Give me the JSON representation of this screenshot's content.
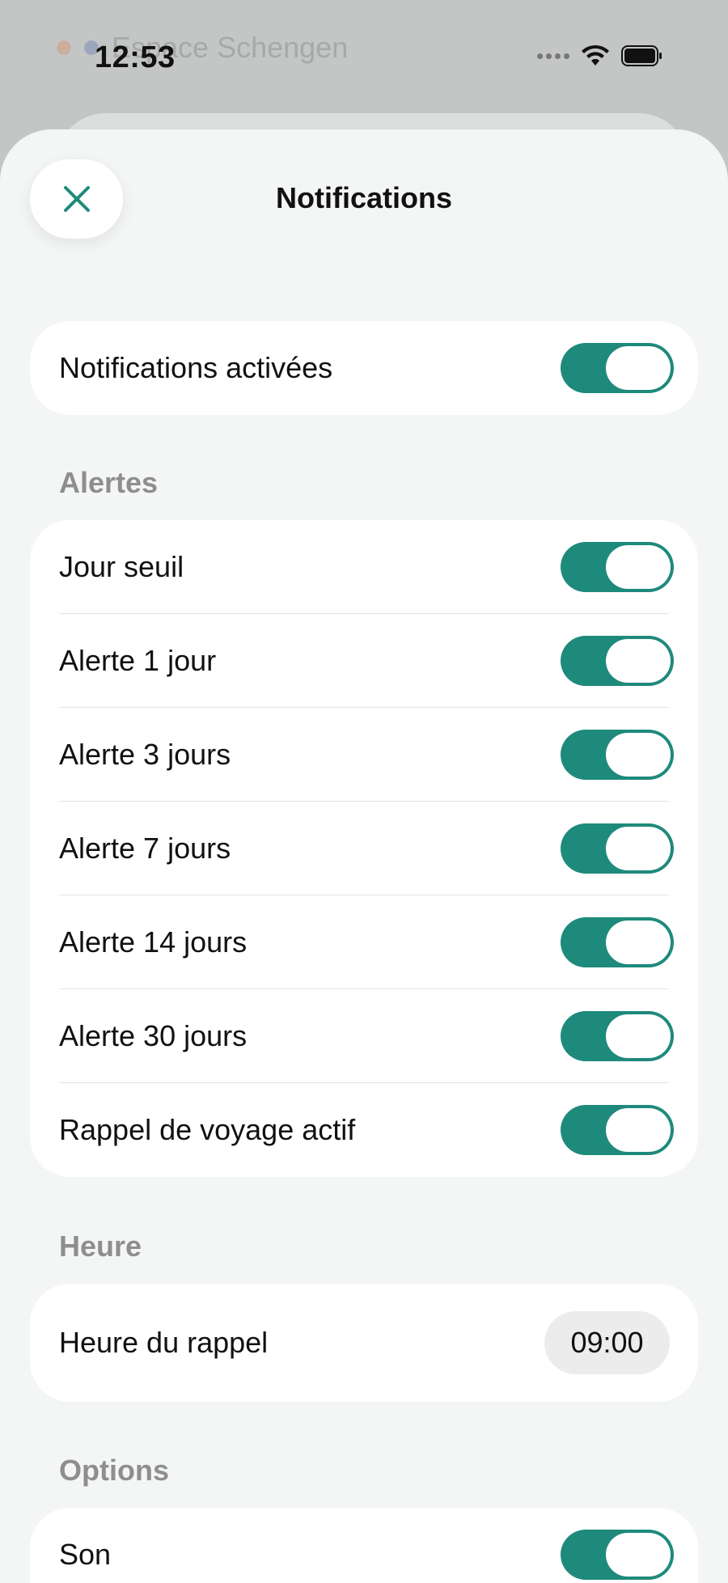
{
  "status_bar": {
    "time": "12:53"
  },
  "background": {
    "row1": "Espace Schengen",
    "row1_right": ""
  },
  "header": {
    "title": "Notifications",
    "close_icon": "close-icon"
  },
  "master": {
    "label": "Notifications activées",
    "enabled": true
  },
  "alerts": {
    "header": "Alertes",
    "items": [
      {
        "label": "Jour seuil",
        "enabled": true
      },
      {
        "label": "Alerte 1 jour",
        "enabled": true
      },
      {
        "label": "Alerte 3 jours",
        "enabled": true
      },
      {
        "label": "Alerte 7 jours",
        "enabled": true
      },
      {
        "label": "Alerte 14 jours",
        "enabled": true
      },
      {
        "label": "Alerte 30 jours",
        "enabled": true
      },
      {
        "label": "Rappel de voyage actif",
        "enabled": true
      }
    ]
  },
  "time_section": {
    "header": "Heure",
    "label": "Heure du rappel",
    "value": "09:00"
  },
  "options": {
    "header": "Options",
    "items": [
      {
        "label": "Son",
        "enabled": true
      }
    ]
  },
  "colors": {
    "accent": "#1e8a7b",
    "sheet_bg": "#f4f6f6",
    "section_header": "#8e8e8e"
  }
}
